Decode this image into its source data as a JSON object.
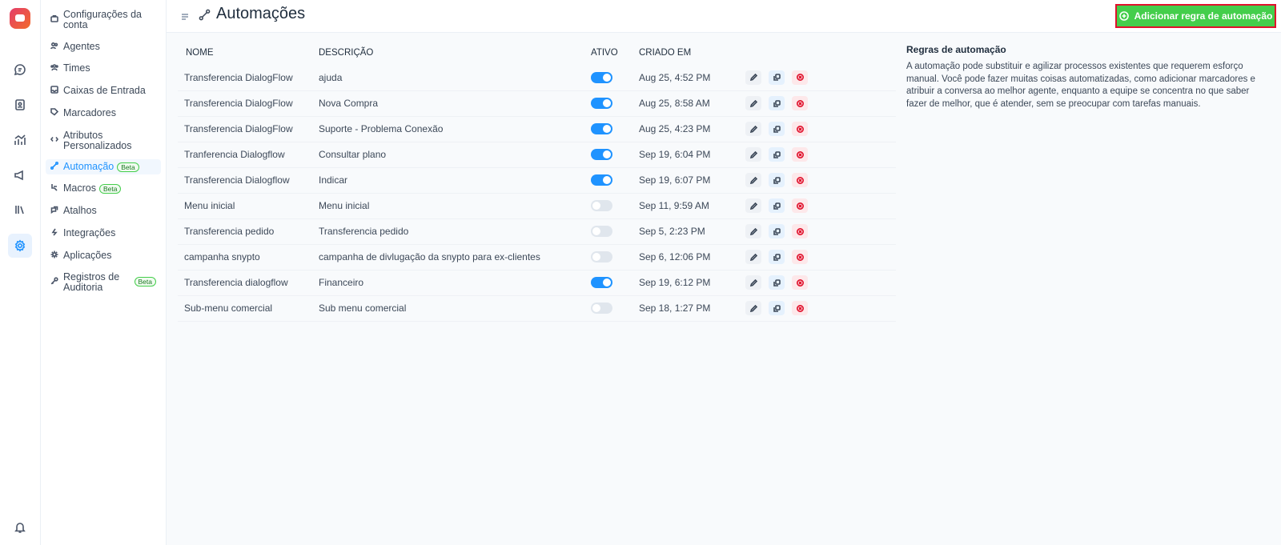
{
  "rail": {
    "icons": [
      "chat-icon",
      "contacts-icon",
      "reports-icon",
      "campaigns-icon",
      "library-icon",
      "settings-icon",
      "bell-icon"
    ]
  },
  "sidebar": {
    "items": [
      {
        "label": "Configurações da conta",
        "icon": "briefcase-icon",
        "active": false
      },
      {
        "label": "Agentes",
        "icon": "people-icon",
        "active": false
      },
      {
        "label": "Times",
        "icon": "team-icon",
        "active": false
      },
      {
        "label": "Caixas de Entrada",
        "icon": "inbox-icon",
        "active": false
      },
      {
        "label": "Marcadores",
        "icon": "tag-icon",
        "active": false
      },
      {
        "label": "Atributos Personalizados",
        "icon": "code-icon",
        "active": false
      },
      {
        "label": "Automação",
        "icon": "automation-icon",
        "active": true,
        "badge": "Beta"
      },
      {
        "label": "Macros",
        "icon": "macro-icon",
        "active": false,
        "badge": "Beta"
      },
      {
        "label": "Atalhos",
        "icon": "shortcut-icon",
        "active": false
      },
      {
        "label": "Integrações",
        "icon": "plug-icon",
        "active": false
      },
      {
        "label": "Aplicações",
        "icon": "apps-icon",
        "active": false
      },
      {
        "label": "Registros de Auditoria",
        "icon": "key-icon",
        "active": false,
        "badge": "Beta"
      }
    ]
  },
  "header": {
    "title": "Automações",
    "add_button": "Adicionar regra de automação"
  },
  "table": {
    "headers": {
      "name": "NOME",
      "description": "DESCRIÇÃO",
      "active": "ATIVO",
      "created": "CRIADO EM"
    },
    "rows": [
      {
        "name": "Transferencia DialogFlow",
        "description": "ajuda",
        "active": true,
        "created": "Aug 25, 4:52 PM"
      },
      {
        "name": "Transferencia DialogFlow",
        "description": "Nova Compra",
        "active": true,
        "created": "Aug 25, 8:58 AM"
      },
      {
        "name": "Transferencia DialogFlow",
        "description": "Suporte - Problema Conexão",
        "active": true,
        "created": "Aug 25, 4:23 PM"
      },
      {
        "name": "Tranferencia Dialogflow",
        "description": "Consultar plano",
        "active": true,
        "created": "Sep 19, 6:04 PM"
      },
      {
        "name": "Transferencia Dialogflow",
        "description": "Indicar",
        "active": true,
        "created": "Sep 19, 6:07 PM"
      },
      {
        "name": "Menu inicial",
        "description": "Menu inicial",
        "active": false,
        "created": "Sep 11, 9:59 AM"
      },
      {
        "name": "Transferencia pedido",
        "description": "Transferencia pedido",
        "active": false,
        "created": "Sep 5, 2:23 PM"
      },
      {
        "name": "campanha snypto",
        "description": "campanha de divlugação da snypto para ex-clientes",
        "active": false,
        "created": "Sep 6, 12:06 PM"
      },
      {
        "name": "Transferencia dialogflow",
        "description": "Financeiro",
        "active": true,
        "created": "Sep 19, 6:12 PM"
      },
      {
        "name": "Sub-menu comercial",
        "description": "Sub menu comercial",
        "active": false,
        "created": "Sep 18, 1:27 PM"
      }
    ]
  },
  "info": {
    "title": "Regras de automação",
    "text": "A automação pode substituir e agilizar processos existentes que requerem esforço manual. Você pode fazer muitas coisas automatizadas, como adicionar marcadores e atribuir a conversa ao melhor agente, enquanto a equipe se concentra no que saber fazer de melhor, que é atender, sem se preocupar com tarefas manuais."
  },
  "colors": {
    "accent": "#1f93ff",
    "success": "#44ce4b",
    "danger": "#e0102b"
  }
}
